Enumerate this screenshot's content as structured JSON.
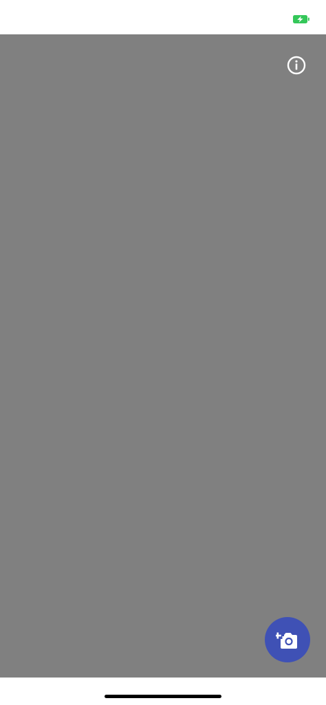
{
  "status_bar": {
    "battery_state": "charging",
    "battery_color": "#34c759"
  },
  "camera_view": {
    "background_color": "#808080"
  },
  "info_button": {
    "icon": "info-circle-icon"
  },
  "fab": {
    "icon": "add-photo-camera-icon",
    "background_color": "#3f51b5"
  },
  "colors": {
    "accent": "#3f51b5",
    "status_green": "#34c759"
  }
}
